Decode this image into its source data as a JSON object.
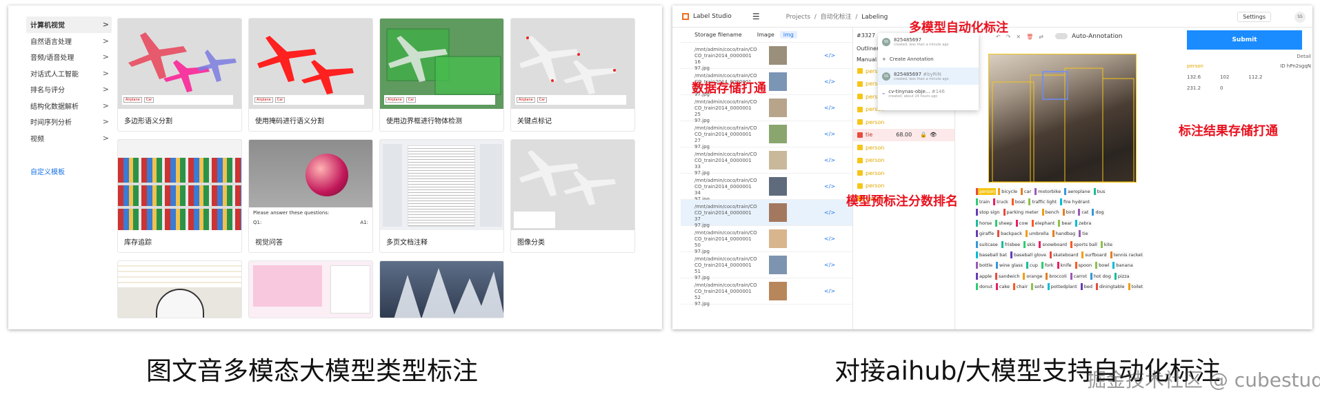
{
  "left_panel": {
    "sidebar": {
      "items": [
        {
          "label": "计算机视觉",
          "active": true
        },
        {
          "label": "自然语言处理"
        },
        {
          "label": "音频/语音处理"
        },
        {
          "label": "对话式人工智能"
        },
        {
          "label": "排名与评分"
        },
        {
          "label": "结构化数据解析"
        },
        {
          "label": "时间序列分析"
        },
        {
          "label": "视频"
        }
      ],
      "chevron": ">",
      "custom_template": "自定义模板"
    },
    "cards": [
      {
        "label": "多边形语义分割"
      },
      {
        "label": "使用掩码进行语义分割"
      },
      {
        "label": "使用边界框进行物体检测"
      },
      {
        "label": "关键点标记"
      },
      {
        "label": "库存追踪"
      },
      {
        "label": "视觉问答"
      },
      {
        "label": "多页文档注释"
      },
      {
        "label": "图像分类"
      }
    ],
    "vqa_prompt": "Please answer these questions:",
    "vqa_q": "Q1:",
    "vqa_a": "A1:"
  },
  "right_panel": {
    "app_title": "Label Studio",
    "breadcrumb": {
      "projects": "Projects",
      "project": "自动化标注",
      "current": "Labeling",
      "sep": "/"
    },
    "settings": "Settings",
    "list_header": {
      "storage": "Storage filename",
      "image": "Image",
      "img_tag": "img"
    },
    "task_id": "#3327",
    "rows": [
      {
        "line1": "/mnt/admin/coco/train/CO",
        "line2": "CO_train2014_0000001 16",
        "line3": "97.jpg"
      },
      {
        "line1": "/mnt/admin/coco/train/CO",
        "line2": "CO_train2014_0000001 24",
        "line3": "97.jpg"
      },
      {
        "line1": "/mnt/admin/coco/train/CO",
        "line2": "CO_train2014_0000001 25",
        "line3": "97.jpg"
      },
      {
        "line1": "/mnt/admin/coco/train/CO",
        "line2": "CO_train2014_0000001 27",
        "line3": "97.jpg"
      },
      {
        "line1": "/mnt/admin/coco/train/CO",
        "line2": "CO_train2014_0000001 33",
        "line3": "97.jpg"
      },
      {
        "line1": "/mnt/admin/coco/train/CO",
        "line2": "CO_train2014_0000001 34",
        "line3": "97.jpg"
      },
      {
        "line1": "/mnt/admin/coco/train/CO",
        "line2": "CO_train2014_0000001 37",
        "line3": "97.jpg"
      },
      {
        "line1": "/mnt/admin/coco/train/CO",
        "line2": "CO_train2014_0000001 50",
        "line3": "97.jpg"
      },
      {
        "line1": "/mnt/admin/coco/train/CO",
        "line2": "CO_train2014_0000001 51",
        "line3": "97.jpg"
      },
      {
        "line1": "/mnt/admin/coco/train/CO",
        "line2": "CO_train2014_0000001 52",
        "line3": "97.jpg"
      }
    ],
    "link_glyph": "</>",
    "outliner": "Outliner",
    "manual": "Manual",
    "regions": [
      {
        "label": "person"
      },
      {
        "label": "person"
      },
      {
        "label": "person"
      },
      {
        "label": "person"
      },
      {
        "label": "person"
      },
      {
        "label": "tie",
        "score": "68.00"
      },
      {
        "label": "person"
      },
      {
        "label": "person"
      },
      {
        "label": "person"
      },
      {
        "label": "person"
      },
      {
        "label": "person"
      }
    ],
    "annotations": {
      "top_id": "825485697",
      "top_sub": "created, less than a minute ago",
      "create": "Create Annotation",
      "mid_id": "825485697",
      "mid_tag": "#byRiN",
      "mid_sub": "created, less than a minute ago",
      "bot_id": "cv-tinynas-obje...",
      "bot_tag": "#146",
      "bot_sub": "created, about 24 hours ago"
    },
    "auto_annotation": "Auto-Annotation",
    "submit": "Submit",
    "detail": "Detail",
    "detail_label": "person",
    "detail_id": "ID hPn2sgqN",
    "detail_vals": [
      "132.6",
      "102",
      "112.2",
      "231.2",
      "0"
    ],
    "chips": [
      [
        "person",
        "bicycle",
        "car",
        "motorbike",
        "aeroplane",
        "bus"
      ],
      [
        "train",
        "truck",
        "boat",
        "traffic light",
        "fire hydrant"
      ],
      [
        "stop sign",
        "parking meter",
        "bench",
        "bird",
        "cat",
        "dog"
      ],
      [
        "horse",
        "sheep",
        "cow",
        "elephant",
        "bear",
        "zebra"
      ],
      [
        "giraffe",
        "backpack",
        "umbrella",
        "handbag",
        "tie"
      ],
      [
        "suitcase",
        "frisbee",
        "skis",
        "snowboard",
        "sports ball",
        "kite"
      ],
      [
        "baseball bat",
        "baseball glove",
        "skateboard",
        "surfboard",
        "tennis racket"
      ],
      [
        "bottle",
        "wine glass",
        "cup",
        "fork",
        "knife",
        "spoon",
        "bowl",
        "banana"
      ],
      [
        "apple",
        "sandwich",
        "orange",
        "broccoli",
        "carrot",
        "hot dog",
        "pizza"
      ],
      [
        "donut",
        "cake",
        "chair",
        "sofa",
        "pottedplant",
        "bed",
        "diningtable",
        "toilet"
      ]
    ],
    "red_labels": {
      "multi_model": "多模型自动化标注",
      "data_storage": "数据存储打通",
      "result_storage": "标注结果存储打通",
      "pre_score": "模型预标注分数排名"
    }
  },
  "captions": {
    "left": "图文音多模态大模型类型标注",
    "right": "对接aihub/大模型支持自动化标注"
  },
  "watermark": "掘金技术社区 @ cubestudio",
  "colors": {
    "accent": "#1a8cff",
    "annotation_red": "#e8121f",
    "logo_orange": "#f16a1f"
  }
}
